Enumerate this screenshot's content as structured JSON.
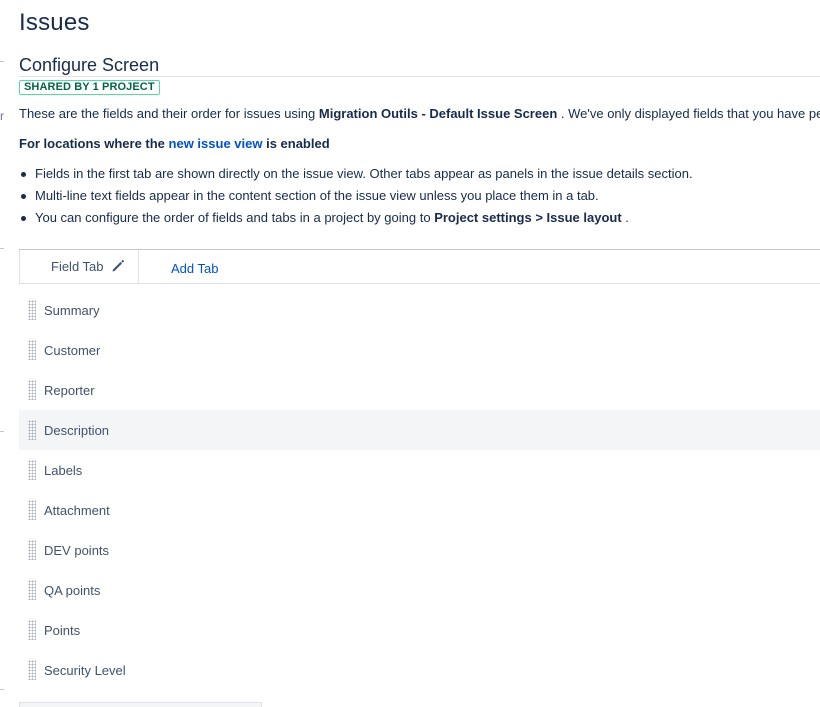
{
  "page": {
    "title": "Issues"
  },
  "screen": {
    "title": "Configure Screen",
    "shared_badge": "SHARED BY 1 PROJECT",
    "description": {
      "prefix": "These are the fields and their order for issues using ",
      "screen_name": "Migration Outils - Default Issue Screen",
      "suffix": " . We've only displayed fields that you have per"
    },
    "left_edge_char": "r"
  },
  "locations": {
    "heading_prefix": "For locations where the ",
    "link": "new issue view",
    "heading_suffix": " is enabled",
    "bullets": [
      {
        "text": "Fields in the first tab are shown directly on the issue view. Other tabs appear as panels in the issue details section."
      },
      {
        "text": "Multi-line text fields appear in the content section of the issue view unless you place them in a tab."
      },
      {
        "prefix": "You can configure the order of fields and tabs in a project by going to ",
        "bold": "Project settings > Issue layout",
        "suffix": " ."
      }
    ]
  },
  "tabs": {
    "active": "Field Tab",
    "add": "Add Tab"
  },
  "fields": [
    "Summary",
    "Customer",
    "Reporter",
    "Description",
    "Labels",
    "Attachment",
    "DEV points",
    "QA points",
    "Points",
    "Security Level"
  ],
  "colors": {
    "link": "#0052cc",
    "text": "#172b4d",
    "badge_border": "#57d9a3",
    "badge_text": "#006644",
    "row_highlight": "#f4f5f7"
  }
}
